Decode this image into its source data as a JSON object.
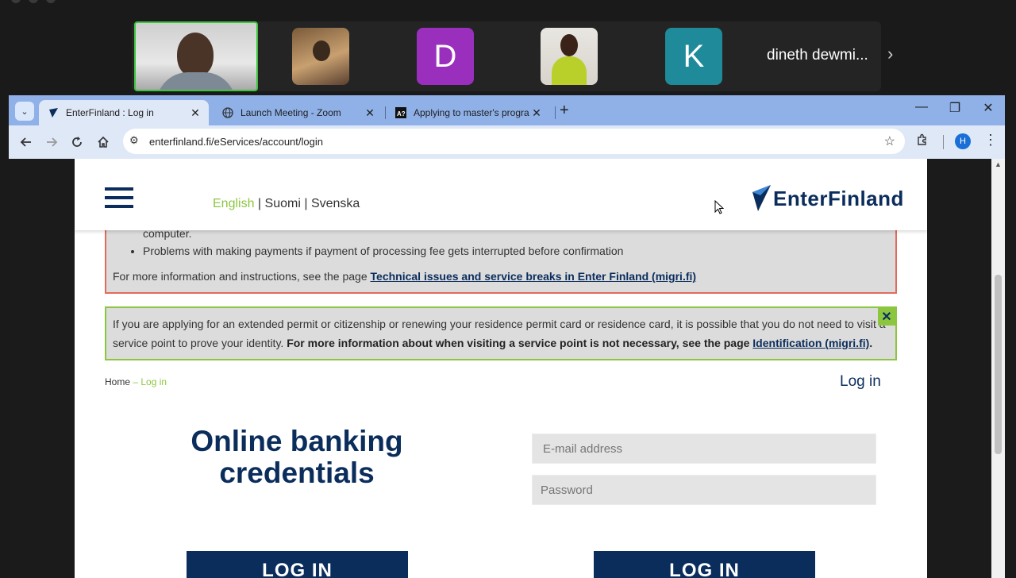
{
  "zoom": {
    "participants": [
      {
        "type": "video"
      },
      {
        "type": "photo"
      },
      {
        "type": "initial",
        "letter": "D",
        "color": "#9a2fbe"
      },
      {
        "type": "photo"
      },
      {
        "type": "initial",
        "letter": "K",
        "color": "#1f8a9a"
      }
    ],
    "overflow_name": "dineth dewmi...",
    "next_icon": "›"
  },
  "browser": {
    "tabs": [
      {
        "title": "EnterFinland : Log in",
        "icon": "enterfinland-icon",
        "active": true
      },
      {
        "title": "Launch Meeting - Zoom",
        "icon": "globe-icon",
        "active": false
      },
      {
        "title": "Applying to master's programm",
        "icon": "aalto-icon",
        "active": false
      }
    ],
    "url": "enterfinland.fi/eServices/account/login",
    "profile_initial": "H"
  },
  "site": {
    "languages": {
      "english": "English",
      "sep1": " | ",
      "suomi": "Suomi",
      "sep2": " | ",
      "svenska": "Svenska"
    },
    "logo_text": "EnterFinland",
    "notice_red": {
      "continuation": "computer.",
      "bullet": "Problems with making payments if payment of processing fee gets interrupted before confirmation",
      "more_prefix": "For more information and instructions, see the page ",
      "more_link": "Technical issues and service breaks in Enter Finland (migri.fi)"
    },
    "notice_green": {
      "line1": "If you are applying for an extended permit or citizenship or renewing your residence permit card or residence card, it is possible that you do not need to visit a",
      "line2_prefix": "service point to prove your identity. ",
      "line2_bold": "For more information about when visiting a service point is not necessary, see the page ",
      "line2_link": "Identification (migri.fi)",
      "line2_end": "."
    },
    "breadcrumb": {
      "home": "Home",
      "sep": " – ",
      "current": "Log in"
    },
    "login_title": "Log in",
    "bank_heading_line1": "Online banking",
    "bank_heading_line2": "credentials",
    "email_placeholder": "E-mail address",
    "password_placeholder": "Password",
    "login_button_left": "LOG IN",
    "login_button_right": "LOG IN"
  },
  "colors": {
    "brand_navy": "#0b2d5c",
    "brand_green": "#8cc63f",
    "notice_red_border": "#e36b5b"
  }
}
